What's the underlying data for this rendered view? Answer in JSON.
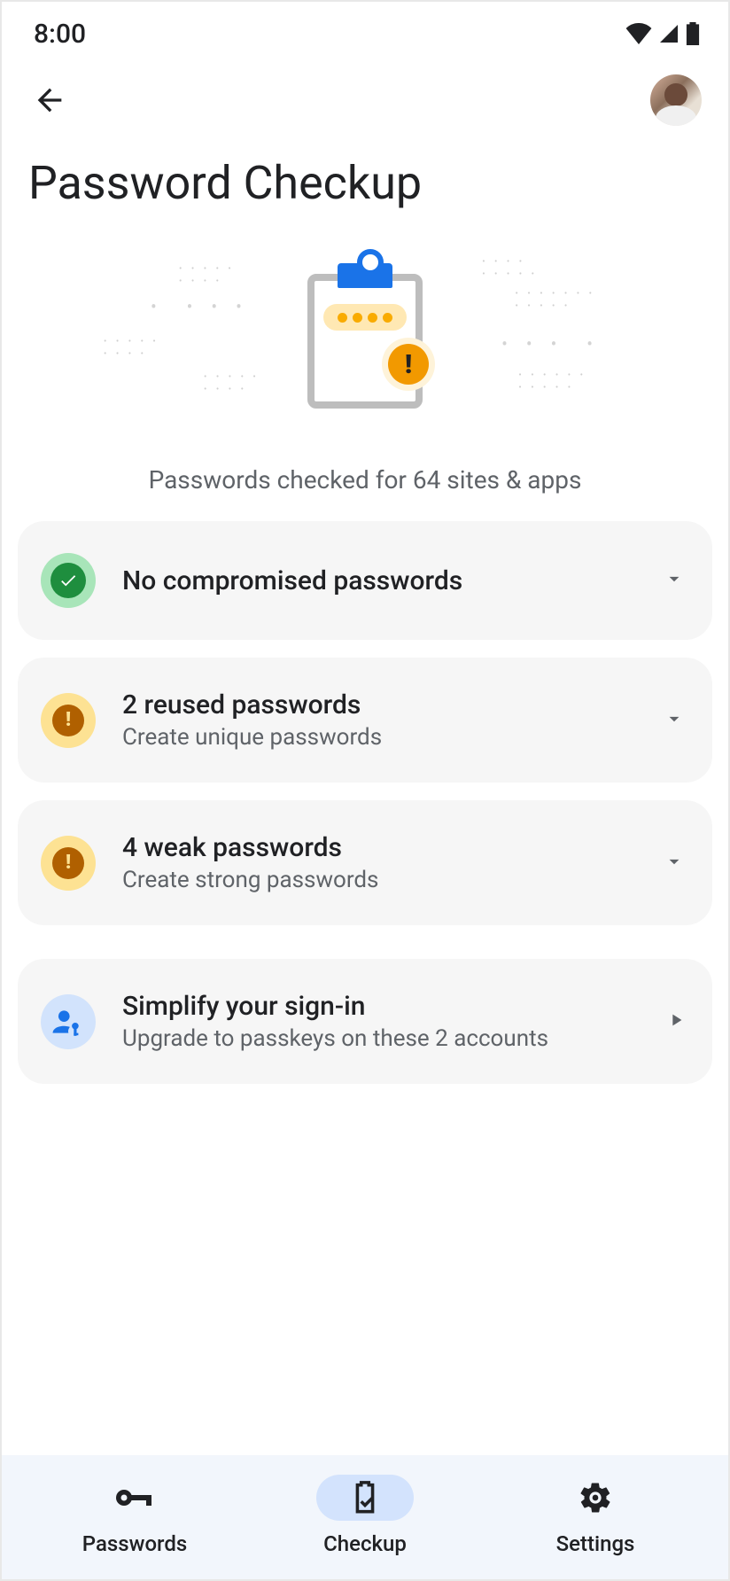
{
  "status": {
    "time": "8:00"
  },
  "page": {
    "title": "Password Checkup",
    "subtitle": "Passwords checked for 64 sites & apps"
  },
  "cards": {
    "compromised": {
      "title": "No compromised passwords",
      "subtitle": ""
    },
    "reused": {
      "title": "2 reused passwords",
      "subtitle": "Create unique passwords"
    },
    "weak": {
      "title": "4 weak passwords",
      "subtitle": "Create strong passwords"
    },
    "passkeys": {
      "title": "Simplify your sign-in",
      "subtitle": "Upgrade to passkeys on these 2 accounts"
    }
  },
  "nav": {
    "passwords": "Passwords",
    "checkup": "Checkup",
    "settings": "Settings"
  }
}
